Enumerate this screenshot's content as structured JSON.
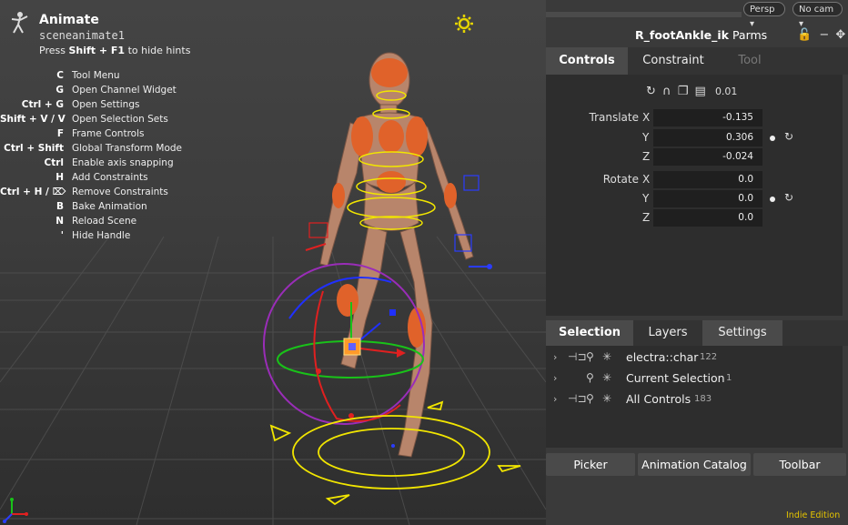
{
  "viewport": {
    "app_title": "Animate",
    "scene_name": "sceneanimate1",
    "hint_prefix": "Press ",
    "hint_key": "Shift + F1",
    "hint_suffix": " to hide hints",
    "hotkeys": [
      {
        "key": "C",
        "desc": "Tool Menu"
      },
      {
        "key": "G",
        "desc": "Open Channel Widget"
      },
      {
        "key": "Ctrl + G",
        "desc": "Open Settings"
      },
      {
        "key": "Shift + V / V",
        "desc": "Open Selection Sets"
      },
      {
        "key": "F",
        "desc": "Frame Controls"
      },
      {
        "key": "Ctrl + Shift",
        "desc": "Global Transform Mode"
      },
      {
        "key": "Ctrl",
        "desc": "Enable axis snapping"
      },
      {
        "key": "H",
        "desc": "Add Constraints"
      },
      {
        "key": "Ctrl + H / ⌦",
        "desc": "Remove Constraints"
      },
      {
        "key": "B",
        "desc": "Bake Animation"
      },
      {
        "key": "N",
        "desc": "Reload Scene"
      },
      {
        "key": "'",
        "desc": "Hide Handle"
      }
    ]
  },
  "panel": {
    "view_menu": "Persp",
    "cam_menu": "No cam",
    "parms_node": "R_footAnkle_ik",
    "parms_suffix": " Parms",
    "tabs_top": [
      "Controls",
      "Constraint",
      "Tool"
    ],
    "step_value": "0.01",
    "translate_label": "Translate",
    "rotate_label": "Rotate",
    "translate": {
      "x": "-0.135",
      "y": "0.306",
      "z": "-0.024"
    },
    "rotate": {
      "x": "0.0",
      "y": "0.0",
      "z": "0.0"
    },
    "axis_x": "X",
    "axis_y": "Y",
    "axis_z": "Z",
    "tabs_bottom": [
      "Selection",
      "Layers",
      "Settings"
    ],
    "tree": [
      {
        "name": "electra::char",
        "count": "122"
      },
      {
        "name": "Current Selection",
        "count": "1"
      },
      {
        "name": "All Controls",
        "count": "183"
      }
    ],
    "buttons": [
      "Picker",
      "Animation Catalog",
      "Toolbar"
    ],
    "edition": "Indie Edition"
  },
  "colors": {
    "accent_yellow": "#e5c400",
    "handle_orange": "#ff7a1a",
    "bg_dark": "#2d2d2d"
  }
}
